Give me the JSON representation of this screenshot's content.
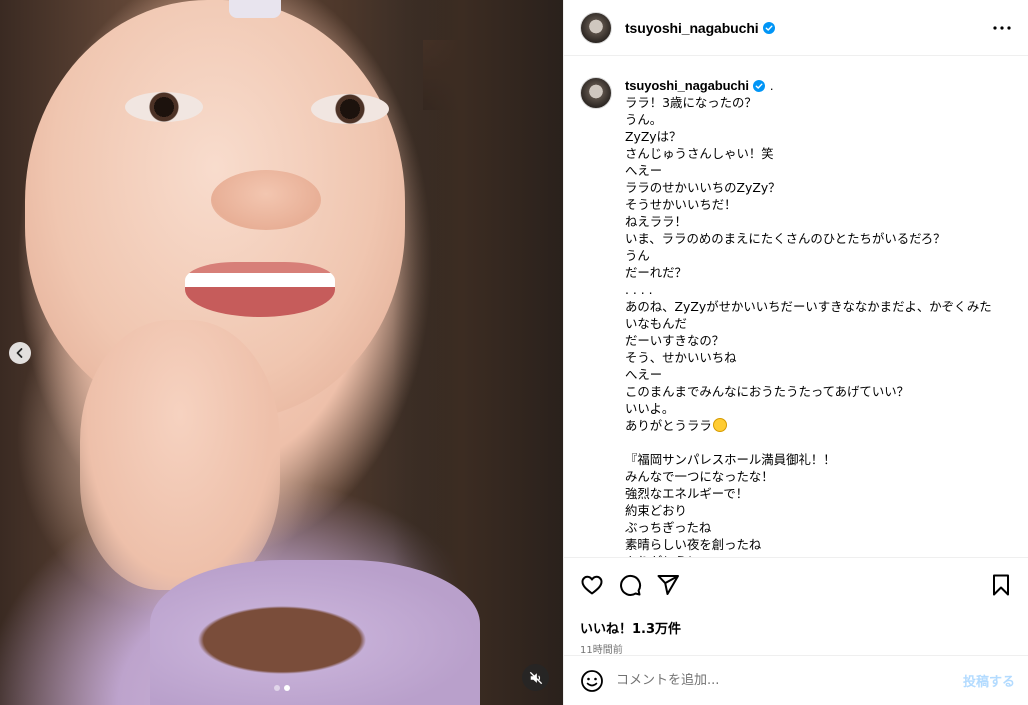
{
  "post": {
    "username": "tsuyoshi_nagabuchi",
    "more_label": "•••",
    "media": {
      "carousel_count": 2,
      "active_index": 1
    }
  },
  "caption": {
    "username": "tsuyoshi_nagabuchi",
    "suffix": ".",
    "lines": [
      "ララ！3歳になったの？",
      "うん。",
      "ZyZyは？",
      "さんじゅうさんしゃい！笑",
      "へえー",
      "ララのせかいいちのZyZy？",
      "そうせかいいちだ！",
      "ねえララ！",
      "いま、ララのめのまえにたくさんのひとたちがいるだろ？",
      "うん",
      "だーれだ？",
      ". . . .",
      "あのね、ZyZyがせかいいちだーいすきななかまだよ、かぞくみた",
      "いなもんだ",
      "だーいすきなの？",
      "そう、せかいいちね",
      "へえー",
      "このまんまでみんなにおうたうたってあげていい？",
      "いいよ。",
      "ありがとうララ",
      "",
      "『福岡サンパレスホール満員御礼！！",
      "みんなで一つになったな！",
      "強烈なエネルギーで！",
      "約束どおり",
      "ぶっちぎったね",
      "素晴らしい夜を創ったね",
      "ありがとう！"
    ]
  },
  "actions": {
    "likes": "いいね！1.3万件",
    "time": "11時間前"
  },
  "comment_box": {
    "placeholder": "コメントを追加...",
    "post_label": "投稿する"
  },
  "colors": {
    "verified": "#0095f6",
    "post_button_disabled": "#b3dbff",
    "secondary_text": "#737373"
  },
  "icons": [
    "chevron-left-icon",
    "mute-icon",
    "verified-badge-icon",
    "heart-icon",
    "comment-icon",
    "share-icon",
    "bookmark-icon",
    "emoji-icon",
    "more-icon"
  ]
}
